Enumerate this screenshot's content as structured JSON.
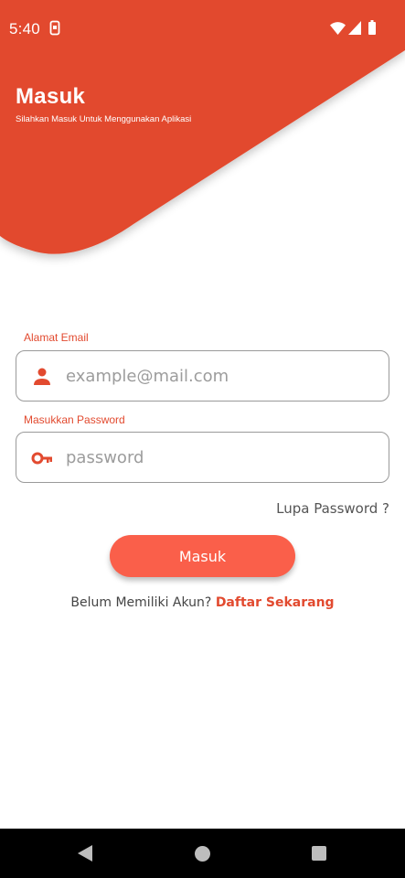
{
  "status_bar": {
    "time": "5:40",
    "icons": [
      "sim-icon",
      "wifi-icon",
      "signal-icon",
      "battery-icon"
    ]
  },
  "header": {
    "title": "Masuk",
    "subtitle": "Silahkan Masuk Untuk Menggunakan Aplikasi"
  },
  "form": {
    "email": {
      "label": "Alamat Email",
      "placeholder": "example@mail.com",
      "value": "",
      "icon": "person-icon"
    },
    "password": {
      "label": "Masukkan Password",
      "placeholder": "password",
      "value": "",
      "icon": "key-icon"
    },
    "forgot_label": "Lupa Password ?",
    "submit_label": "Masuk"
  },
  "register": {
    "prompt": "Belum Memiliki Akun?",
    "link_label": "Daftar Sekarang"
  },
  "navigation": {
    "buttons": [
      "back-icon",
      "home-icon",
      "recents-icon"
    ]
  },
  "colors": {
    "header_background": "#e24a2f",
    "accent": "#e24a2f",
    "button_background": "#fa5f4a",
    "navigation_background": "#000000"
  }
}
